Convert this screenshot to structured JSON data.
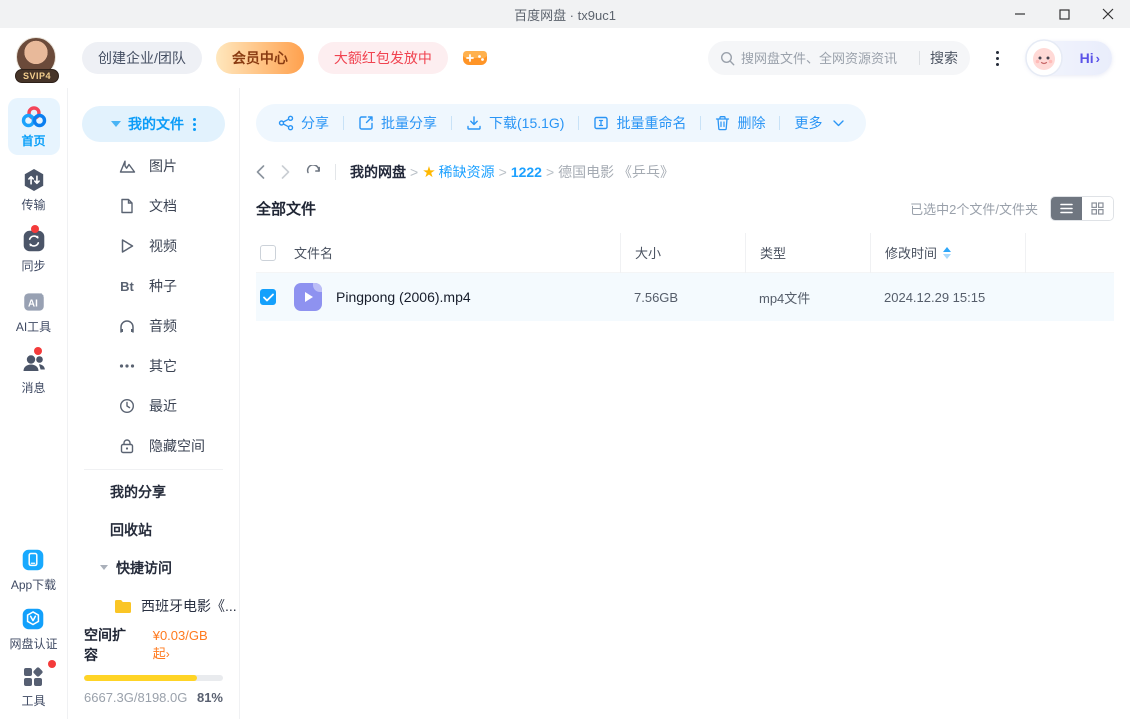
{
  "titlebar": {
    "title": "百度网盘 · tx9uc1"
  },
  "topnav": {
    "avatar_badge": "SVIP4",
    "create_team": "创建企业/团队",
    "vip_center": "会员中心",
    "red_packet": "大额红包发放中",
    "search": {
      "placeholder": "搜网盘文件、全网资源资讯",
      "button": "搜索"
    },
    "assistant_label": "Hi",
    "assistant_chevron": "›"
  },
  "rail": {
    "home": "首页",
    "transfer": "传输",
    "sync": "同步",
    "ai_tools": "AI工具",
    "messages": "消息",
    "app_download": "App下载",
    "verify": "网盘认证",
    "tools": "工具"
  },
  "sidebar": {
    "my_files": "我的文件",
    "categories": [
      {
        "label": "图片"
      },
      {
        "label": "文档"
      },
      {
        "label": "视频"
      },
      {
        "label": "种子",
        "icon_text": "Bt"
      },
      {
        "label": "音频"
      },
      {
        "label": "其它"
      },
      {
        "label": "最近"
      },
      {
        "label": "隐藏空间"
      }
    ],
    "my_share": "我的分享",
    "recycle": "回收站",
    "quick_access": "快捷访问",
    "quick_item": "西班牙电影《...",
    "storage": {
      "expand": "空间扩容",
      "price": "¥0.03/GB起",
      "chevron": "›",
      "usage": "6667.3G/8198.0G",
      "percent": "81%",
      "percent_value": 81
    }
  },
  "toolbar": {
    "share": "分享",
    "batch_share": "批量分享",
    "download": "下载(15.1G)",
    "batch_rename": "批量重命名",
    "delete": "删除",
    "more": "更多"
  },
  "breadcrumb": {
    "separator": ">",
    "root": "我的网盘",
    "level1": "稀缺资源",
    "level2": "1222",
    "current": "德国电影 《乒乓》"
  },
  "filelist": {
    "section_title": "全部文件",
    "selection_info": "已选中2个文件/文件夹",
    "columns": {
      "name": "文件名",
      "size": "大小",
      "type": "类型",
      "modified": "修改时间"
    },
    "rows": [
      {
        "name": "Pingpong (2006).mp4",
        "size": "7.56GB",
        "type": "mp4文件",
        "modified": "2024.12.29 15:15"
      }
    ]
  },
  "colors": {
    "accent_blue": "#06a7ff",
    "toolbar_bg": "#eff7fe",
    "selected_row_bg": "#f4fafe",
    "vip_gradient": "#ffe7bd → #ffa14e",
    "red_packet_text": "#f04350",
    "storage_bar_fill": "#ffd426",
    "price_orange": "#ff7a1e",
    "folder_yellow": "#fac525",
    "video_icon_purple": "#8e92f0"
  }
}
